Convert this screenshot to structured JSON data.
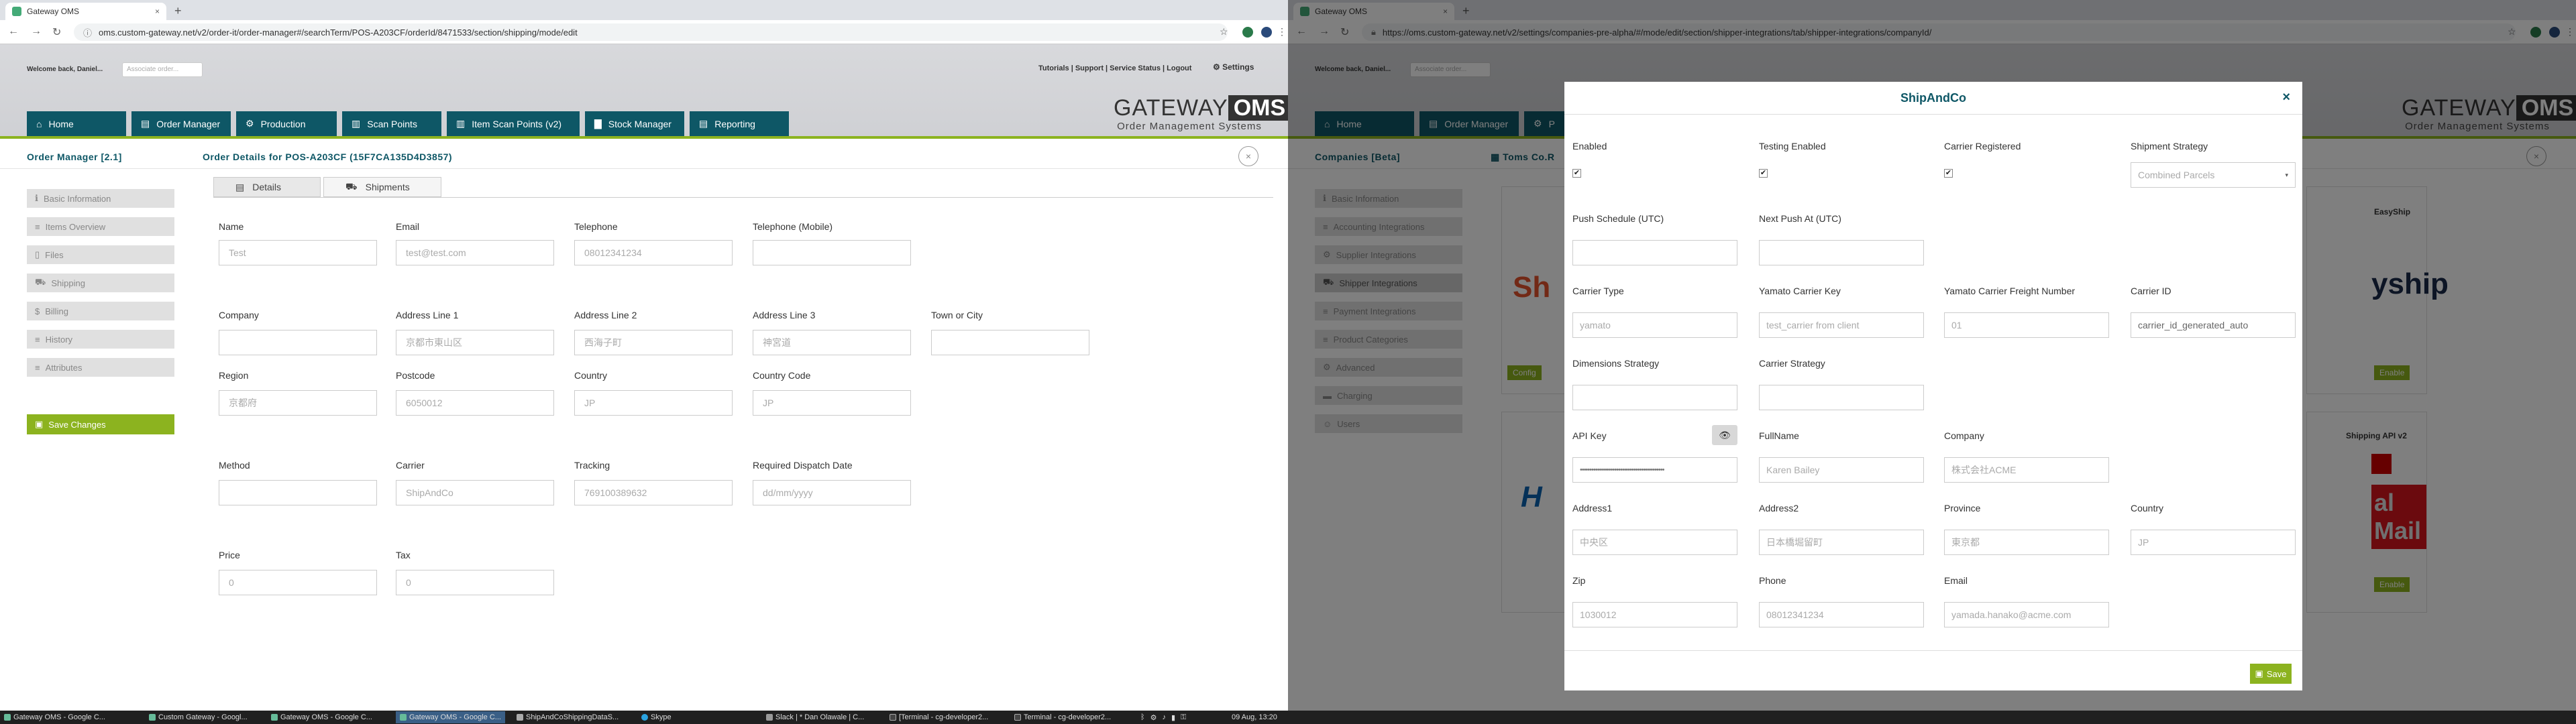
{
  "left": {
    "browser": {
      "tab_title": "Gateway OMS",
      "tab_close": "×",
      "new_tab": "+",
      "url": "oms.custom-gateway.net/v2/order-it/order-manager#/searchTerm/POS-A203CF/orderId/8471533/section/shipping/mode/edit"
    },
    "header": {
      "welcome": "Welcome back, Daniel...",
      "switcher_placeholder": "Associate order...",
      "links": "Tutorials | Support | Service Status | Logout",
      "settings": "Settings",
      "logo_a": "GATEWAY",
      "logo_b": "OMS",
      "logo_c": "Order Management Systems"
    },
    "nav": [
      "Home",
      "Order Manager",
      "Production",
      "Scan Points",
      "Item Scan Points (v2)",
      "Stock Manager",
      "Reporting"
    ],
    "page_title": "Order Manager [2.1]",
    "order_title": "Order Details for POS-A203CF (15F7CA135D4D3857)",
    "sidebar": [
      "Basic Information",
      "Items Overview",
      "Files",
      "Shipping",
      "Billing",
      "History",
      "Attributes"
    ],
    "save_changes": "Save Changes",
    "tabs": [
      "Details",
      "Shipments"
    ],
    "form": {
      "name_label": "Name",
      "name": "Test",
      "email_label": "Email",
      "email": "test@test.com",
      "telephone_label": "Telephone",
      "telephone": "08012341234",
      "mobile_label": "Telephone (Mobile)",
      "mobile": "",
      "company_label": "Company",
      "company": "",
      "addr1_label": "Address Line 1",
      "addr1": "京都市東山区",
      "addr2_label": "Address Line 2",
      "addr2": "西海子町",
      "addr3_label": "Address Line 3",
      "addr3": "神宮道",
      "town_label": "Town or City",
      "town": "",
      "region_label": "Region",
      "region": "京都府",
      "postcode_label": "Postcode",
      "postcode": "6050012",
      "country_label": "Country",
      "country": "JP",
      "country_code_label": "Country Code",
      "country_code": "JP",
      "method_label": "Method",
      "method": "",
      "carrier_label": "Carrier",
      "carrier": "ShipAndCo",
      "tracking_label": "Tracking",
      "tracking": "769100389632",
      "dispatch_label": "Required Dispatch Date",
      "dispatch_placeholder": "dd/mm/yyyy",
      "price_label": "Price",
      "price": "0",
      "tax_label": "Tax",
      "tax": "0"
    }
  },
  "right": {
    "browser": {
      "tab_title": "Gateway OMS",
      "tab_close": "×",
      "new_tab": "+",
      "url": "https://oms.custom-gateway.net/v2/settings/companies-pre-alpha/#/mode/edit/section/shipper-integrations/tab/shipper-integrations/companyId/"
    },
    "header": {
      "welcome": "Welcome back, Daniel...",
      "switcher_placeholder": "Associate order...",
      "logo_a": "GATEWAY",
      "logo_b": "OMS",
      "logo_c": "Order Management Systems"
    },
    "nav": [
      "Home",
      "Order Manager",
      "P"
    ],
    "page_title": "Companies [Beta]",
    "company_title": "Toms Co.R",
    "sidebar": [
      "Basic Information",
      "Accounting Integrations",
      "Supplier Integrations",
      "Shipper Integrations",
      "Payment Integrations",
      "Product Categories",
      "Advanced",
      "Charging",
      "Users"
    ],
    "bg_cards": {
      "easyship_title": "EasyShip",
      "easyship_logo": "yship",
      "enable": "Enable",
      "configure": "Config",
      "royalmail_title": "Shipping API v2",
      "royalmail_logo": "al Mail",
      "hermes_logo": "H",
      "ship_logo": "Sh"
    },
    "modal": {
      "title": "ShipAndCo",
      "close": "×",
      "enabled_label": "Enabled",
      "testing_label": "Testing Enabled",
      "registered_label": "Carrier Registered",
      "strategy_label": "Shipment Strategy",
      "strategy_value": "Combined Parcels",
      "push_schedule_label": "Push Schedule (UTC)",
      "next_push_label": "Next Push At (UTC)",
      "carrier_type_label": "Carrier Type",
      "carrier_type": "yamato",
      "yamato_key_label": "Yamato Carrier Key",
      "yamato_key": "test_carrier from client",
      "yamato_freight_label": "Yamato Carrier Freight Number",
      "yamato_freight": "01",
      "carrier_id_label": "Carrier ID",
      "carrier_id": "carrier_id_generated_auto",
      "dimensions_label": "Dimensions Strategy",
      "carrier_strategy_label": "Carrier Strategy",
      "api_key_label": "API Key",
      "api_key": "••••••••••••••••••••••••••••••••••••••••••••",
      "fullname_label": "FullName",
      "fullname": "Karen Bailey",
      "company_label": "Company",
      "company": "株式会社ACME",
      "address1_label": "Address1",
      "address1": "中央区",
      "address2_label": "Address2",
      "address2": "日本橋堀留町",
      "province_label": "Province",
      "province": "東京都",
      "country_label": "Country",
      "country": "JP",
      "zip_label": "Zip",
      "zip": "1030012",
      "phone_label": "Phone",
      "phone": "08012341234",
      "email_label": "Email",
      "email": "yamada.hanako@acme.com",
      "save": "Save"
    }
  },
  "taskbar": {
    "items": [
      "Gateway OMS - Google C...",
      "Custom Gateway - Googl...",
      "Gateway OMS - Google C...",
      "Gateway OMS - Google C...",
      "ShipAndCoShippingDataS...",
      "Skype",
      "Slack | * Dan Olawale | C...",
      "[Terminal - cg-developer2...",
      "Terminal - cg-developer2..."
    ],
    "clock": "09 Aug, 13:20"
  },
  "colors": {
    "teal": "#0e5766",
    "green": "#8cb31f"
  }
}
